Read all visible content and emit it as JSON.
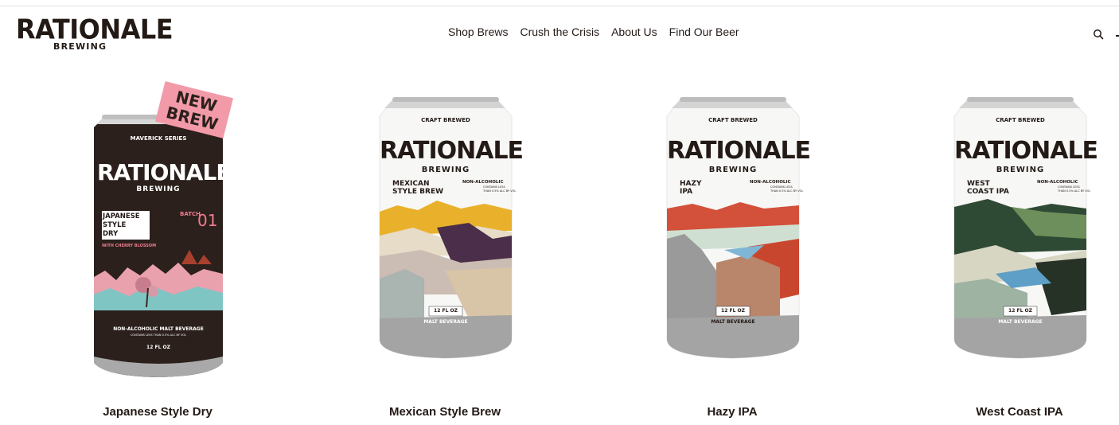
{
  "brand": {
    "name": "RATIONALE",
    "subtitle": "BREWING"
  },
  "nav": {
    "items": [
      "Shop Brews",
      "Crush the Crisis",
      "About Us",
      "Find Our Beer"
    ]
  },
  "header": {
    "search_icon": "search-icon"
  },
  "products": [
    {
      "name": "Japanese Style Dry",
      "badge": "NEW BREW",
      "series": "MAVERICK SERIES",
      "brand": "RATIONALE",
      "brand_sub": "BREWING",
      "style_lines": [
        "JAPANESE",
        "STYLE",
        "DRY"
      ],
      "batch_label": "BATCH",
      "batch_no": "01",
      "flavor": "WITH CHERRY BLOSSOM",
      "beverage": "NON-ALCOHOLIC MALT BEVERAGE",
      "fine_print": "CONTAINS LESS THAN 0.5% ALC BY VOL",
      "volume": "12 FL OZ",
      "can_color": "#2b201c"
    },
    {
      "name": "Mexican Style Brew",
      "top_label": "CRAFT BREWED",
      "brand": "RATIONALE",
      "brand_sub": "BREWING",
      "style_lines": [
        "MEXICAN",
        "STYLE BREW"
      ],
      "na": "NON-ALCOHOLIC",
      "fine_print_lines": [
        "CONTAINS LESS",
        "THAN 0.5% ALC BY VOL"
      ],
      "volume": "12 FL OZ",
      "beverage": "MALT BEVERAGE",
      "can_color": "#f7f7f5"
    },
    {
      "name": "Hazy IPA",
      "top_label": "CRAFT BREWED",
      "brand": "RATIONALE",
      "brand_sub": "BREWING",
      "style_lines": [
        "HAZY",
        "IPA"
      ],
      "na": "NON-ALCOHOLIC",
      "fine_print_lines": [
        "CONTAINS LESS",
        "THAN 0.5% ALC BY VOL"
      ],
      "volume": "12 FL OZ",
      "beverage": "MALT BEVERAGE",
      "can_color": "#f7f7f5"
    },
    {
      "name": "West Coast IPA",
      "top_label": "CRAFT BREWED",
      "brand": "RATIONALE",
      "brand_sub": "BREWING",
      "style_lines": [
        "WEST",
        "COAST IPA"
      ],
      "na": "NON-ALCOHOLIC",
      "fine_print_lines": [
        "CONTAINS LESS",
        "THAN 0.5% ALC BY VOL"
      ],
      "volume": "12 FL OZ",
      "beverage": "MALT BEVERAGE",
      "can_color": "#f7f7f5"
    }
  ]
}
